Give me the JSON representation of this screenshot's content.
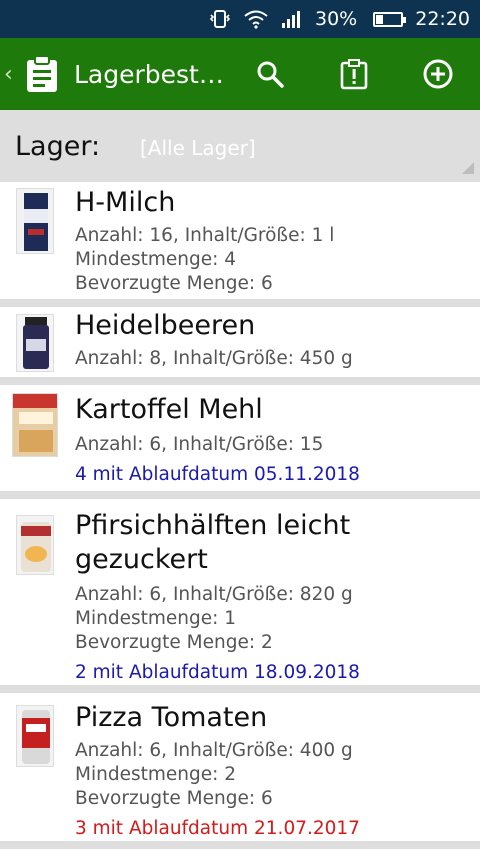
{
  "status_bar": {
    "battery": "30%",
    "time": "22:20",
    "battery_level": 0.3
  },
  "toolbar": {
    "title": "Lagerbest…",
    "icons": [
      "back-chevron",
      "clipboard-icon",
      "search-icon",
      "clipboard-alert-icon",
      "add-circle-icon"
    ]
  },
  "filter": {
    "label": "Lager:",
    "value": "[Alle Lager]"
  },
  "items": [
    {
      "name": "H-Milch",
      "line1": "Anzahl: 16, Inhalt/Größe: 1 l",
      "line2": "Mindestmenge: 4",
      "line3": "Bevorzugte Menge: 6",
      "expiry": ""
    },
    {
      "name": "Heidelbeeren",
      "line1": "Anzahl: 8, Inhalt/Größe: 450 g",
      "line2": "",
      "line3": "",
      "expiry": ""
    },
    {
      "name": "Kartoffel Mehl",
      "line1": "Anzahl: 6, Inhalt/Größe: 15",
      "line2": "",
      "line3": "",
      "expiry": "4 mit Ablaufdatum 05.11.2018"
    },
    {
      "name": "Pfirsichhälften leicht gezuckert",
      "line1": "Anzahl: 6, Inhalt/Größe: 820 g",
      "line2": "Mindestmenge: 1",
      "line3": "Bevorzugte Menge: 2",
      "expiry": "2 mit Ablaufdatum 18.09.2018"
    },
    {
      "name": "Pizza Tomaten",
      "line1": "Anzahl: 6, Inhalt/Größe: 400 g",
      "line2": "Mindestmenge: 2",
      "line3": "Bevorzugte Menge: 6",
      "expiry": "3 mit Ablaufdatum 21.07.2017"
    }
  ],
  "colors": {
    "status_bar": "#0d3350",
    "toolbar": "#1e7a0a",
    "filter_bg": "#dedede",
    "expiry_ok": "#1a1ab0",
    "expiry_overdue": "#d41a1a"
  }
}
